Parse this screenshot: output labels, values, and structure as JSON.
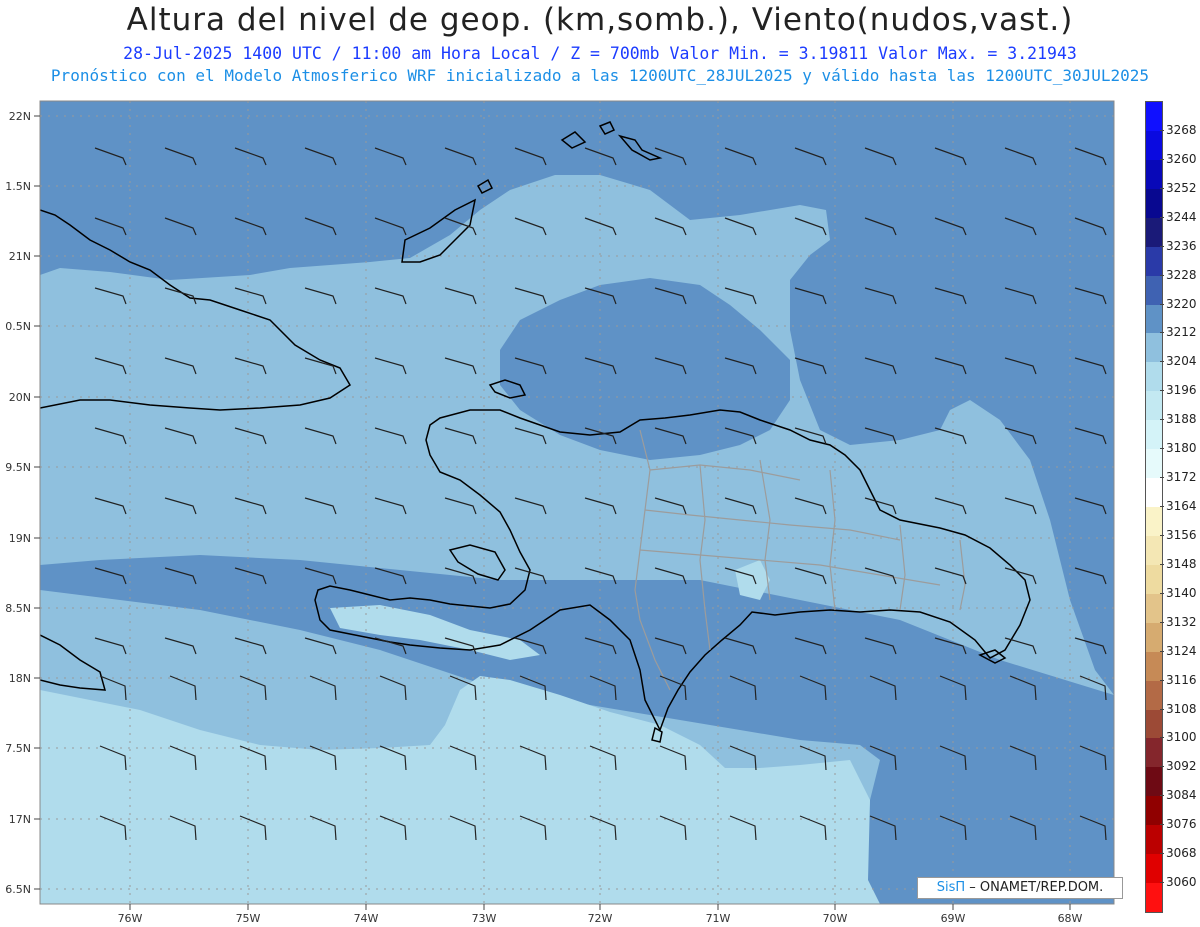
{
  "header": {
    "title": "Altura del nivel de geop. (km,somb.), Viento(nudos,vast.)",
    "subtitle": "28-Jul-2025  1400 UTC / 11:00 am Hora Local / Z = 700mb   Valor Min. = 3.19811  Valor Max. = 3.21943",
    "model_line": "Pronóstico con el Modelo Atmosferico WRF inicializado a las 1200UTC_28JUL2025 y válido hasta las  1200UTC_30JUL2025"
  },
  "map": {
    "lat_labels": [
      "22N",
      "1.5N",
      "21N",
      "0.5N",
      "20N",
      "9.5N",
      "19N",
      "8.5N",
      "18N",
      "7.5N",
      "17N",
      "6.5N"
    ],
    "lon_labels": [
      "76W",
      "75W",
      "74W",
      "73W",
      "72W",
      "71W",
      "70W",
      "69W",
      "68W"
    ]
  },
  "legend": {
    "labels": [
      "3268",
      "3260",
      "3252",
      "3244",
      "3236",
      "3228",
      "3220",
      "3212",
      "3204",
      "3196",
      "3188",
      "3180",
      "3172",
      "3164",
      "3156",
      "3148",
      "3140",
      "3132",
      "3124",
      "3116",
      "3108",
      "3100",
      "3092",
      "3084",
      "3076",
      "3068",
      "3060"
    ],
    "colors": [
      "#1010ff",
      "#0a0ae0",
      "#0808b8",
      "#080890",
      "#1a1a78",
      "#2a3aa8",
      "#3f62b2",
      "#5f92c6",
      "#8fc0de",
      "#b0dcec",
      "#c3e9f2",
      "#d4f3f8",
      "#e6fafb",
      "#ffffff",
      "#faf3c8",
      "#f4e7b4",
      "#eedba0",
      "#e3c48a",
      "#d6ab70",
      "#c68a56",
      "#b36a46",
      "#9c4a36",
      "#84262c",
      "#6e0a14",
      "#900000",
      "#bb0000",
      "#e00000",
      "#ff1010"
    ]
  },
  "credit": {
    "logo_text": "SisΠ",
    "text": "– ONAMET/REP.DOM."
  }
}
